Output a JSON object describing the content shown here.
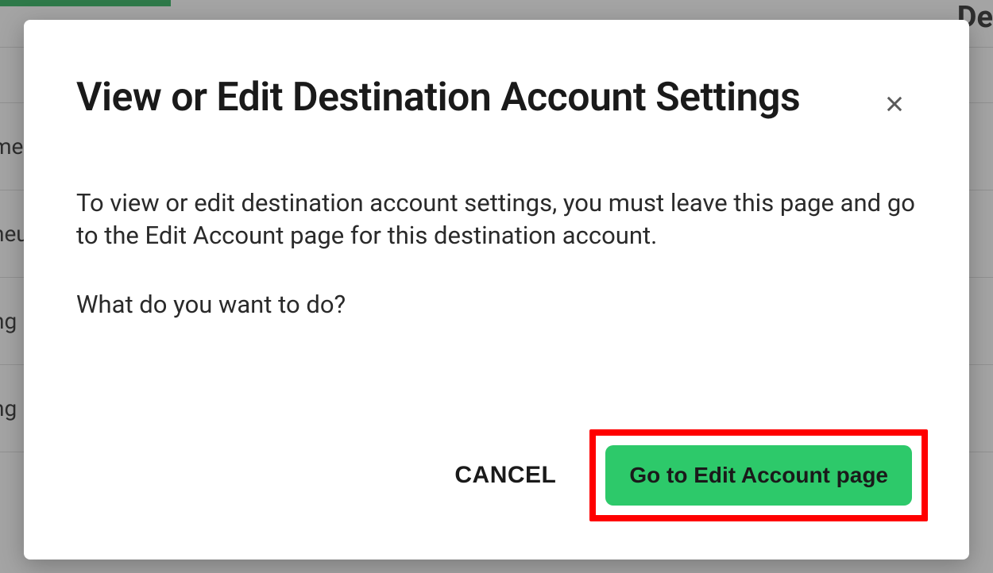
{
  "modal": {
    "title": "View or Edit Destination Account Settings",
    "body_p1": "To view or edit destination account settings, you must leave this page and go to the Edit Account page for this destination account.",
    "body_p2": "What do you want to do?",
    "cancel_label": "CANCEL",
    "primary_label": "Go to Edit Account page"
  },
  "background": {
    "partial_right_text": "De",
    "row_fragments": [
      "me",
      "neu",
      "ng",
      "ng"
    ]
  },
  "colors": {
    "accent_green": "#2dc96a",
    "highlight_red": "#ff0000"
  }
}
